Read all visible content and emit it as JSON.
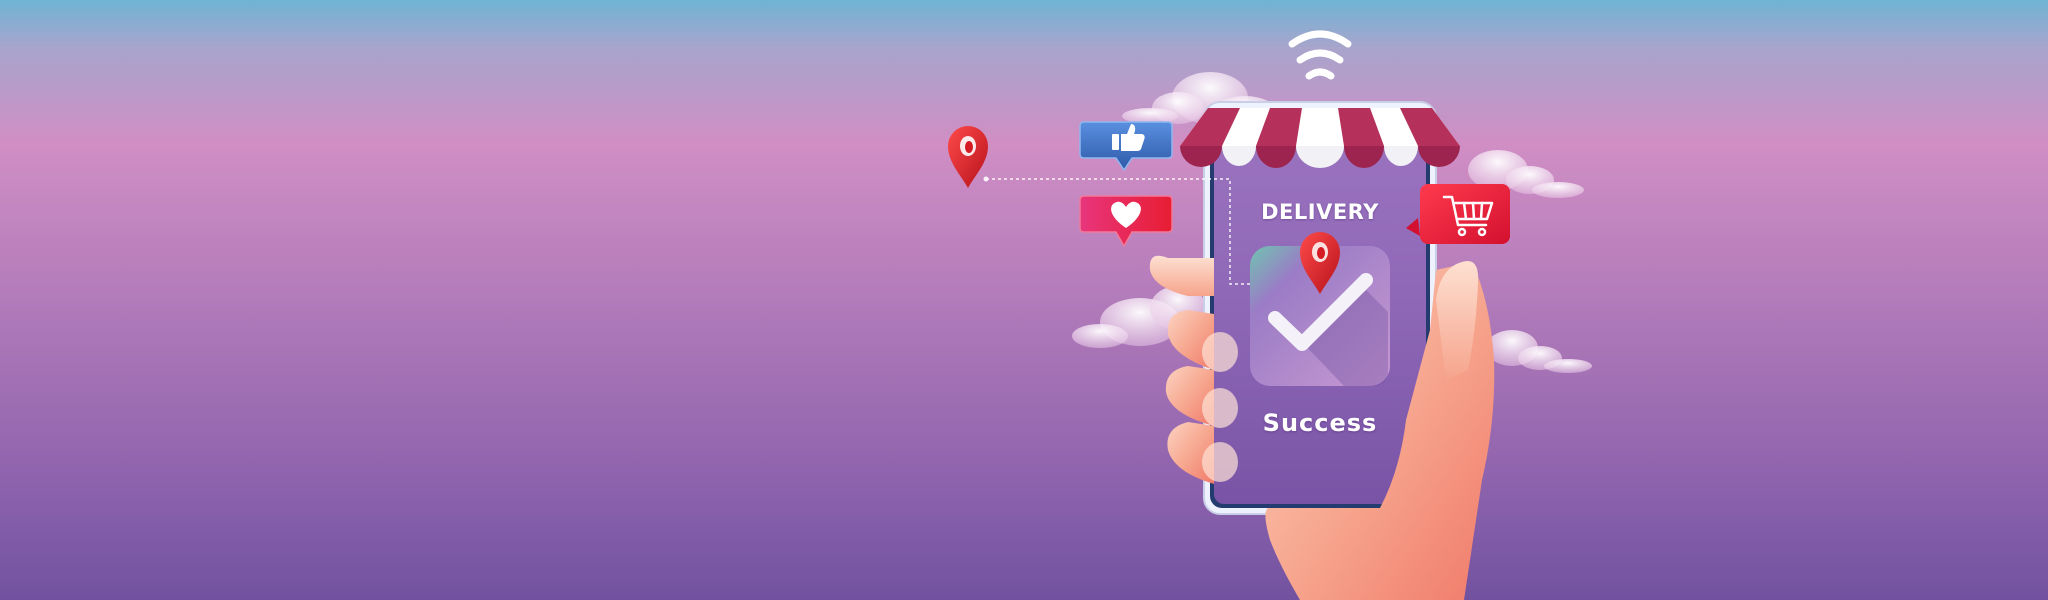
{
  "phone": {
    "header_text": "DELIVERY",
    "status_text": "Success"
  },
  "icons": [
    "wifi-icon",
    "like-icon",
    "heart-icon",
    "shopping-cart-icon",
    "location-pin-icon",
    "checkmark-icon",
    "shop-awning-icon"
  ],
  "colors": {
    "background_top": "#6fb3d4",
    "background_middle": "#cf8ec4",
    "background_bottom": "#7153a2",
    "awning_red": "#b5305a",
    "pin_red": "#e0252f",
    "like_blue": "#3b6fbf",
    "heart_badge_red": "#e62a4a",
    "cart_badge_red": "#e8193e",
    "hand_skin": "#f6a98f"
  }
}
